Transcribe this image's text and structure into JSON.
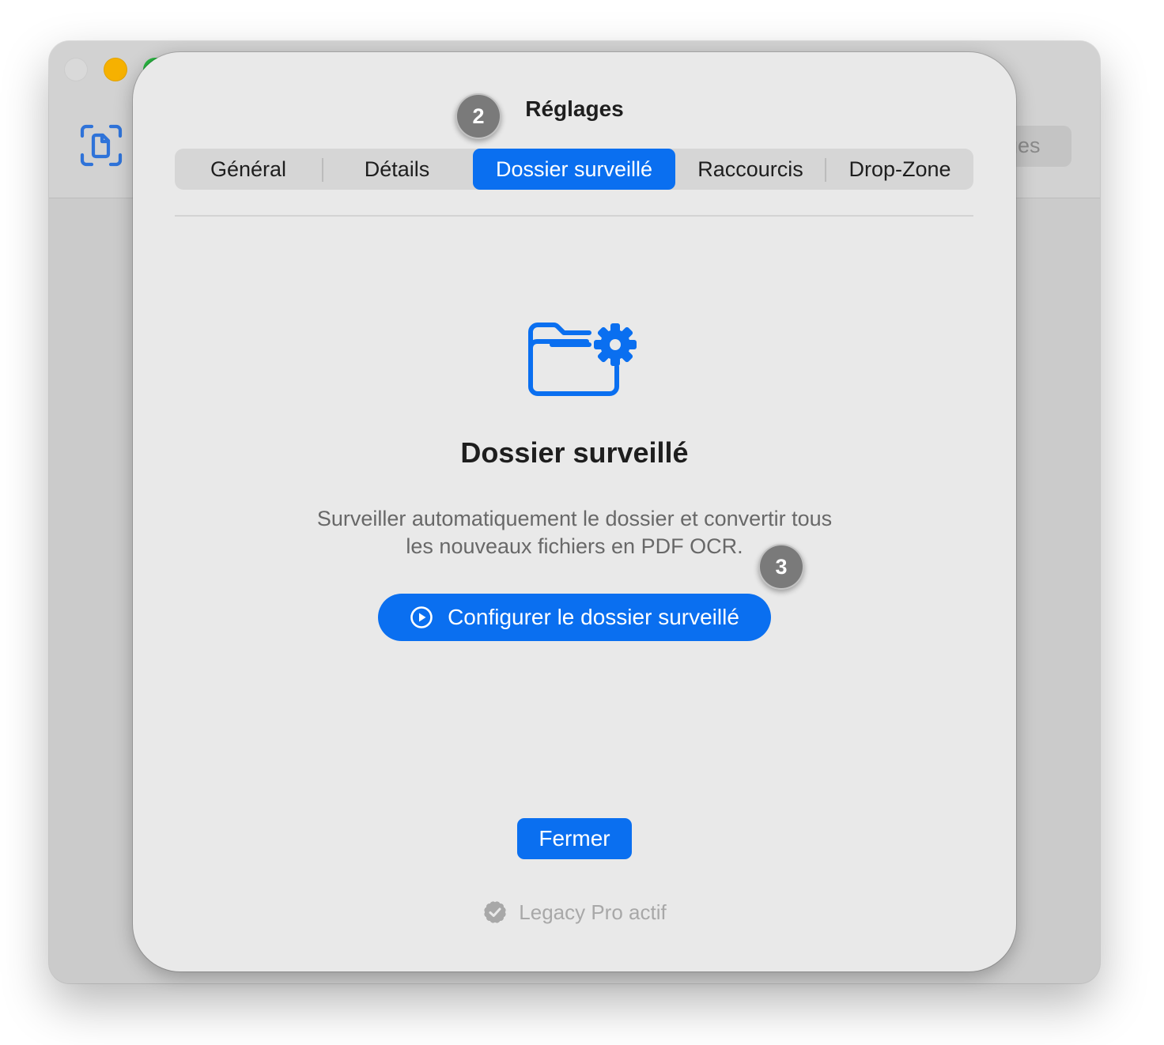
{
  "background_window": {
    "toolbar_button_partial_label": "ges"
  },
  "settings": {
    "title": "Réglages",
    "tabs": [
      {
        "label": "Général"
      },
      {
        "label": "Détails"
      },
      {
        "label": "Dossier surveillé",
        "selected": true
      },
      {
        "label": "Raccourcis"
      },
      {
        "label": "Drop-Zone"
      }
    ],
    "feature": {
      "icon": "folder-gear-icon",
      "title": "Dossier surveillé",
      "description_line1": "Surveiller automatiquement le dossier et convertir tous",
      "description_line2": "les nouveaux fichiers en PDF OCR.",
      "configure_button": "Configurer le dossier surveillé"
    },
    "close_button": "Fermer",
    "license_status": "Legacy Pro actif"
  },
  "step_badges": {
    "badge_2": "2",
    "badge_3": "3"
  },
  "colors": {
    "accent": "#0a6ff0",
    "sheet_background": "#e9e9e9",
    "badge": "#7a7a7a"
  }
}
